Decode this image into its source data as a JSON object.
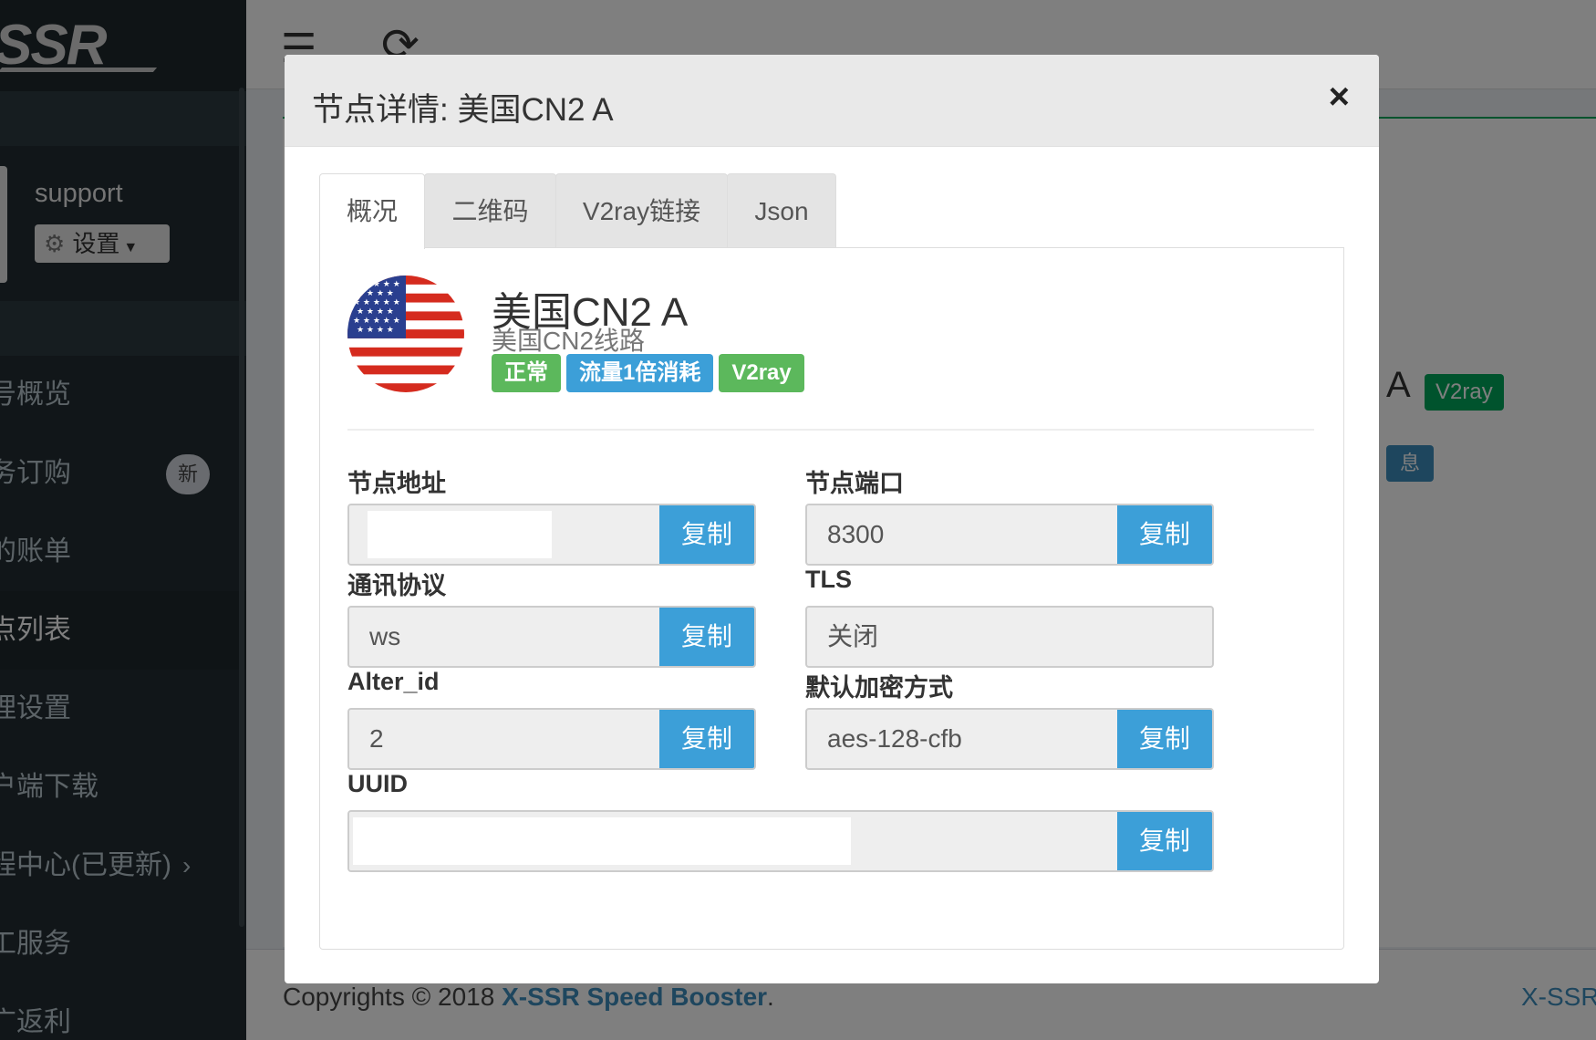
{
  "sidebar": {
    "logo_text": "SSR",
    "user_name": "support",
    "settings_label": "设置",
    "items": [
      {
        "label": "号概览"
      },
      {
        "label": "务订购",
        "badge": "新"
      },
      {
        "label": "的账单"
      },
      {
        "label": "点列表"
      },
      {
        "label": "理设置"
      },
      {
        "label": "户端下载"
      },
      {
        "label": "程中心(已更新)"
      },
      {
        "label": "工服务"
      },
      {
        "label": "广返利"
      }
    ]
  },
  "background": {
    "node_title_fragment": "A",
    "tag": "V2ray",
    "blue_fragment": "息",
    "footer_prefix": "Copyrights © 2018",
    "footer_link": "X-SSR Speed Booster",
    "footer_suffix": ".",
    "footer_right": "X-SSR"
  },
  "modal": {
    "title": "节点详情: 美国CN2 A",
    "close_glyph": "×",
    "tabs": [
      "概况",
      "二维码",
      "V2ray链接",
      "Json"
    ],
    "node": {
      "name": "美国CN2 A",
      "description": "美国CN2线路",
      "badges": [
        {
          "text": "正常",
          "color": "#5cb85c"
        },
        {
          "text": "流量1倍消耗",
          "color": "#3c9fd8"
        },
        {
          "text": "V2ray",
          "color": "#5cb85c"
        }
      ]
    },
    "copy_label": "复制",
    "fields": {
      "address": {
        "label": "节点地址",
        "value": ""
      },
      "port": {
        "label": "节点端口",
        "value": "8300"
      },
      "protocol": {
        "label": "通讯协议",
        "value": "ws"
      },
      "tls": {
        "label": "TLS",
        "value": "关闭"
      },
      "alter_id": {
        "label": "Alter_id",
        "value": "2"
      },
      "encryption": {
        "label": "默认加密方式",
        "value": "aes-128-cfb"
      },
      "uuid": {
        "label": "UUID",
        "value": ""
      }
    }
  },
  "colors": {
    "sidebar_bg": "#222d32",
    "copy_button": "#3c9fd8",
    "badge_green": "#5cb85c",
    "link_blue": "#3c8dbc"
  }
}
